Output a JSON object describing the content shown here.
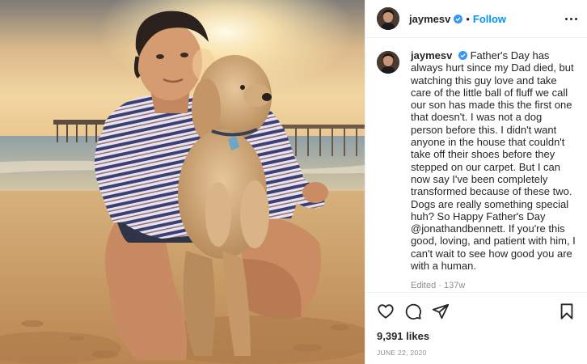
{
  "post": {
    "image_alt": "Man holding a curly golden doodle puppy on a beach at sunset"
  },
  "header": {
    "username": "jaymesv",
    "separator": "•",
    "follow_label": "Follow"
  },
  "caption": {
    "username": "jaymesv",
    "text": "Father's Day has always hurt since my Dad died, but watching this guy love and take care of the little ball of fluff we call our son has made this the first one that doesn't. I was not a dog person before this. I didn't want anyone in the house that couldn't take off their shoes before they stepped on our carpet. But I can now say I've been completely transformed because of these two. Dogs are really something special huh? So Happy Father's Day @jonathandbennett. If you're this good, loving, and patient with him, I can't wait to see how good you are with a human.",
    "meta": "Edited · 137w"
  },
  "actions": {
    "like_icon": "heart-icon",
    "comment_icon": "comment-icon",
    "share_icon": "paper-plane-icon",
    "save_icon": "bookmark-icon"
  },
  "likes": "9,391 likes",
  "date": "June 22, 2020",
  "colors": {
    "accent": "#0095f6",
    "verified": "#3897f0",
    "text": "#262626",
    "muted": "#8e8e8e"
  }
}
